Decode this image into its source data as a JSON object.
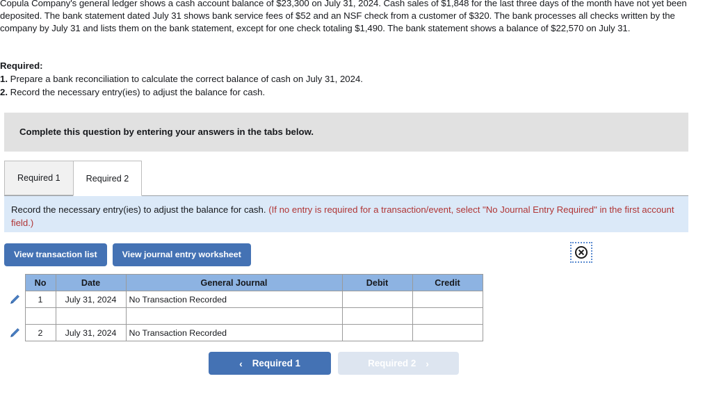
{
  "problem": {
    "text": "Copula Company's general ledger shows a cash account balance of $23,300 on July 31, 2024. Cash sales of $1,848 for the last three days of the month have not yet been deposited. The bank statement dated July 31 shows bank service fees of $52 and an NSF check from a customer of $320. The bank processes all checks written by the company by July 31 and lists them on the bank statement, except for one check totaling $1,490. The bank statement shows a balance of $22,570 on July 31."
  },
  "required": {
    "title": "Required:",
    "items": [
      {
        "num": "1.",
        "text": " Prepare a bank reconciliation to calculate the correct balance of cash on July 31, 2024."
      },
      {
        "num": "2.",
        "text": " Record the necessary entry(ies) to adjust the balance for cash."
      }
    ]
  },
  "instruction_bar": {
    "text": "Complete this question by entering your answers in the tabs below."
  },
  "tabs": [
    {
      "label": "Required 1",
      "active": false
    },
    {
      "label": "Required 2",
      "active": true
    }
  ],
  "panel": {
    "prompt": "Record the necessary entry(ies) to adjust the balance for cash.",
    "note": "(If no entry is required for a transaction/event, select \"No Journal Entry Required\" in the first account field.)"
  },
  "toolbar": {
    "view_transaction_list": "View transaction list",
    "view_journal_entry_worksheet": "View journal entry worksheet",
    "broken_image_icon": "close-circle-icon"
  },
  "table": {
    "headers": [
      "No",
      "Date",
      "General Journal",
      "Debit",
      "Credit"
    ],
    "rows": [
      {
        "edit_icon": "pencil-icon",
        "no": "1",
        "date": "July 31, 2024",
        "general_journal": "No Transaction Recorded",
        "debit": "",
        "credit": ""
      },
      {
        "edit_icon": "",
        "no": "",
        "date": "",
        "general_journal": "",
        "debit": "",
        "credit": ""
      },
      {
        "edit_icon": "pencil-icon",
        "no": "2",
        "date": "July 31, 2024",
        "general_journal": "No Transaction Recorded",
        "debit": "",
        "credit": ""
      }
    ]
  },
  "bottom_nav": {
    "prev_label": "Required 1",
    "prev_chevron": "chevron-left-icon",
    "next_label": "Required 2",
    "next_chevron": "chevron-right-icon"
  },
  "colors": {
    "accent_blue": "#4472b4",
    "table_header_blue": "#8db3e2",
    "panel_blue": "#dbe9f8",
    "gray_bar": "#e1e1e1",
    "note_red": "#b03535",
    "next_disabled": "#dde5f0"
  }
}
